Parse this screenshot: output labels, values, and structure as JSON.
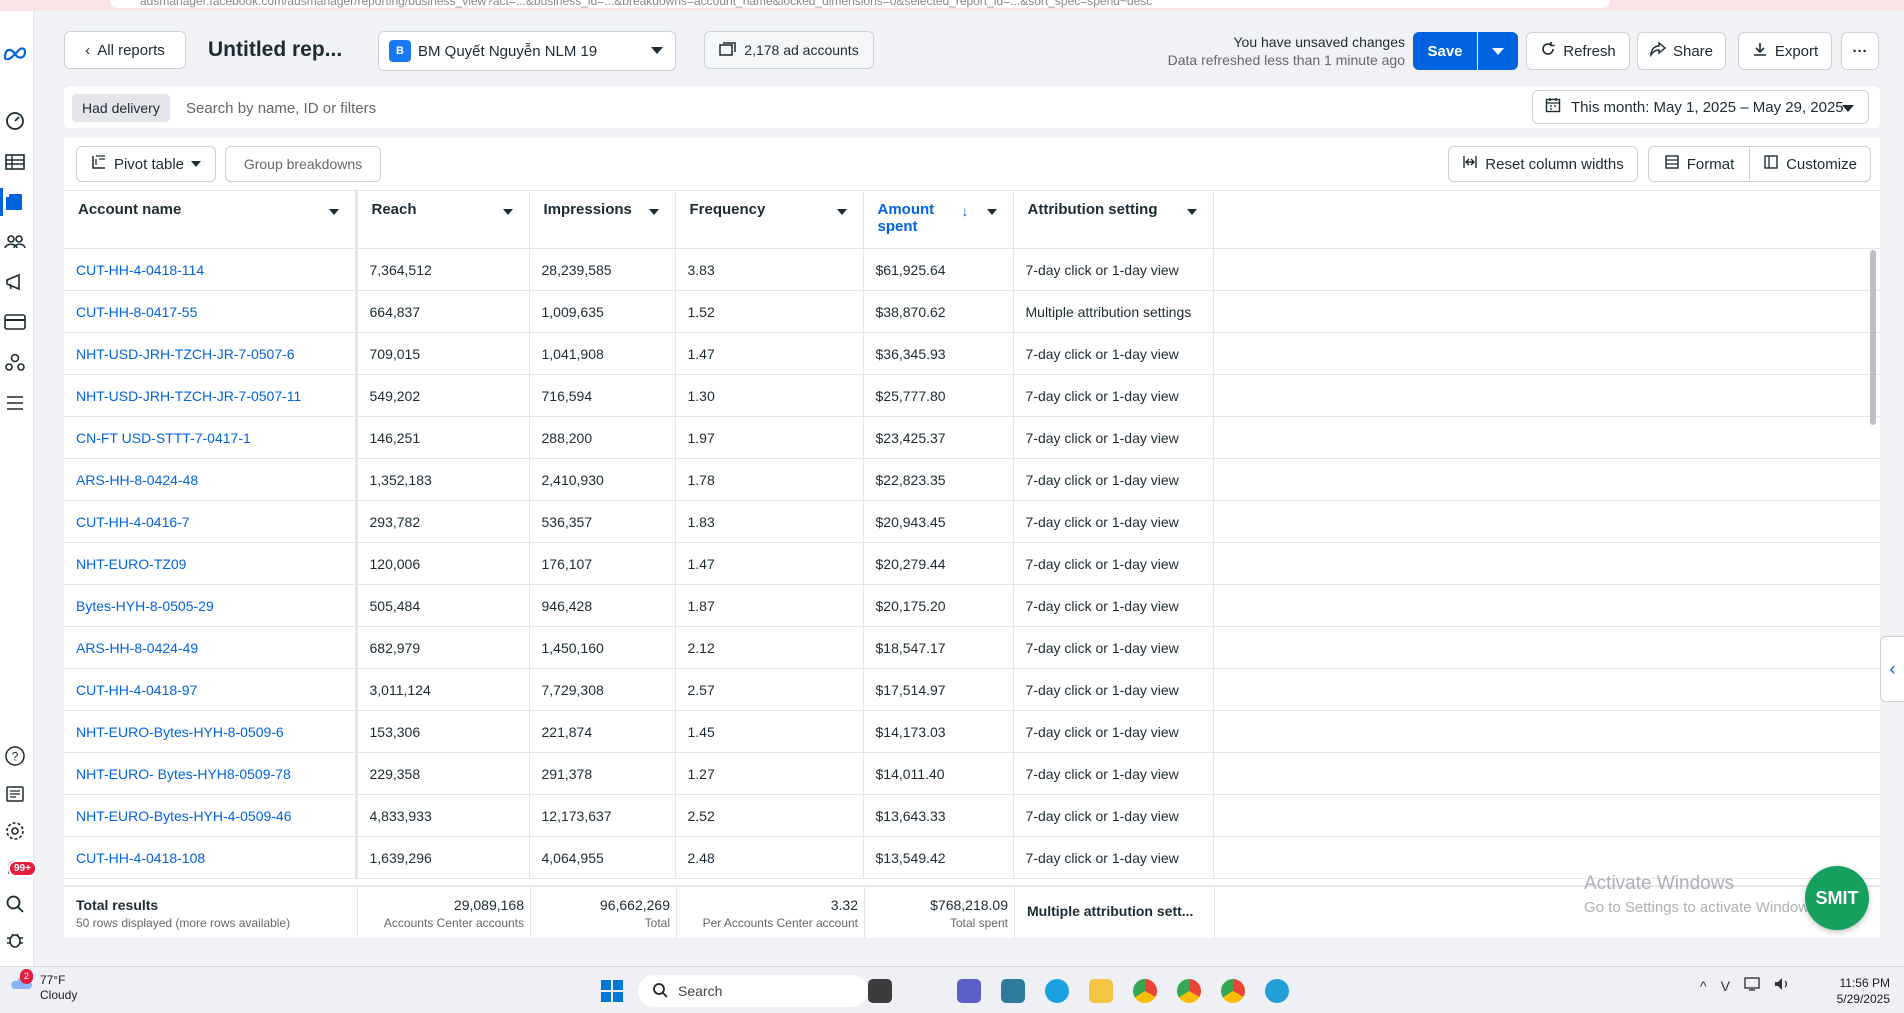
{
  "browser": {
    "url": "adsmanager.facebook.com/adsmanager/reporting/business_view?act=...&business_id=...&breakdowns=account_name&locked_dimensions=0&selected_report_id=...&sort_spec=spend~desc"
  },
  "rail": {
    "notification_badge": "99+"
  },
  "header": {
    "all_reports": "All reports",
    "title": "Untitled rep...",
    "business_initial": "B",
    "business_name": "BM Quyết Nguyễn NLM 19",
    "accounts": "2,178 ad accounts",
    "unsaved": "You have unsaved changes",
    "refreshed": "Data refreshed less than 1 minute ago",
    "save": "Save",
    "refresh": "Refresh",
    "share": "Share",
    "export": "Export",
    "more": "···"
  },
  "filters": {
    "chip": "Had delivery",
    "search_placeholder": "Search by name, ID or filters",
    "date_range": "This month: May 1, 2025 – May 29, 2025"
  },
  "toolbar": {
    "pivot": "Pivot table",
    "group": "Group breakdowns",
    "reset": "Reset column widths",
    "format": "Format",
    "customize": "Customize"
  },
  "columns": {
    "account": "Account name",
    "reach": "Reach",
    "impressions": "Impressions",
    "frequency": "Frequency",
    "amount": "Amount spent",
    "attribution": "Attribution setting"
  },
  "rows": [
    {
      "name": "CUT-HH-4-0418-114",
      "reach": "7,364,512",
      "impr": "28,239,585",
      "freq": "3.83",
      "spent": "$61,925.64",
      "attr": "7-day click or 1-day view"
    },
    {
      "name": "CUT-HH-8-0417-55",
      "reach": "664,837",
      "impr": "1,009,635",
      "freq": "1.52",
      "spent": "$38,870.62",
      "attr": "Multiple attribution settings"
    },
    {
      "name": "NHT-USD-JRH-TZCH-JR-7-0507-6",
      "reach": "709,015",
      "impr": "1,041,908",
      "freq": "1.47",
      "spent": "$36,345.93",
      "attr": "7-day click or 1-day view"
    },
    {
      "name": "NHT-USD-JRH-TZCH-JR-7-0507-11",
      "reach": "549,202",
      "impr": "716,594",
      "freq": "1.30",
      "spent": "$25,777.80",
      "attr": "7-day click or 1-day view"
    },
    {
      "name": "CN-FT USD-STTT-7-0417-1",
      "reach": "146,251",
      "impr": "288,200",
      "freq": "1.97",
      "spent": "$23,425.37",
      "attr": "7-day click or 1-day view"
    },
    {
      "name": "ARS-HH-8-0424-48",
      "reach": "1,352,183",
      "impr": "2,410,930",
      "freq": "1.78",
      "spent": "$22,823.35",
      "attr": "7-day click or 1-day view"
    },
    {
      "name": "CUT-HH-4-0416-7",
      "reach": "293,782",
      "impr": "536,357",
      "freq": "1.83",
      "spent": "$20,943.45",
      "attr": "7-day click or 1-day view"
    },
    {
      "name": "NHT-EURO-TZ09",
      "reach": "120,006",
      "impr": "176,107",
      "freq": "1.47",
      "spent": "$20,279.44",
      "attr": "7-day click or 1-day view"
    },
    {
      "name": "Bytes-HYH-8-0505-29",
      "reach": "505,484",
      "impr": "946,428",
      "freq": "1.87",
      "spent": "$20,175.20",
      "attr": "7-day click or 1-day view"
    },
    {
      "name": "ARS-HH-8-0424-49",
      "reach": "682,979",
      "impr": "1,450,160",
      "freq": "2.12",
      "spent": "$18,547.17",
      "attr": "7-day click or 1-day view"
    },
    {
      "name": "CUT-HH-4-0418-97",
      "reach": "3,011,124",
      "impr": "7,729,308",
      "freq": "2.57",
      "spent": "$17,514.97",
      "attr": "7-day click or 1-day view"
    },
    {
      "name": "NHT-EURO-Bytes-HYH-8-0509-6",
      "reach": "153,306",
      "impr": "221,874",
      "freq": "1.45",
      "spent": "$14,173.03",
      "attr": "7-day click or 1-day view"
    },
    {
      "name": "NHT-EURO- Bytes-HYH8-0509-78",
      "reach": "229,358",
      "impr": "291,378",
      "freq": "1.27",
      "spent": "$14,011.40",
      "attr": "7-day click or 1-day view"
    },
    {
      "name": "NHT-EURO-Bytes-HYH-4-0509-46",
      "reach": "4,833,933",
      "impr": "12,173,637",
      "freq": "2.52",
      "spent": "$13,643.33",
      "attr": "7-day click or 1-day view"
    },
    {
      "name": "CUT-HH-4-0418-108",
      "reach": "1,639,296",
      "impr": "4,064,955",
      "freq": "2.48",
      "spent": "$13,549.42",
      "attr": "7-day click or 1-day view"
    }
  ],
  "totals": {
    "label": "Total results",
    "sub": "50 rows displayed (more rows available)",
    "reach": "29,089,168",
    "reach_label": "Accounts Center accounts",
    "impr": "96,662,269",
    "impr_label": "Total",
    "freq": "3.32",
    "freq_label": "Per Accounts Center account",
    "spent": "$768,218.09",
    "spent_label": "Total spent",
    "attr": "Multiple attribution sett..."
  },
  "overlay": {
    "watermark_title": "Activate Windows",
    "watermark_sub": "Go to Settings to activate Windows.",
    "smit": "SMIT"
  },
  "taskbar": {
    "weather_badge": "2",
    "temp": "77°F",
    "condition": "Cloudy",
    "search": "Search",
    "time": "11:56 PM",
    "date": "5/29/2025"
  }
}
